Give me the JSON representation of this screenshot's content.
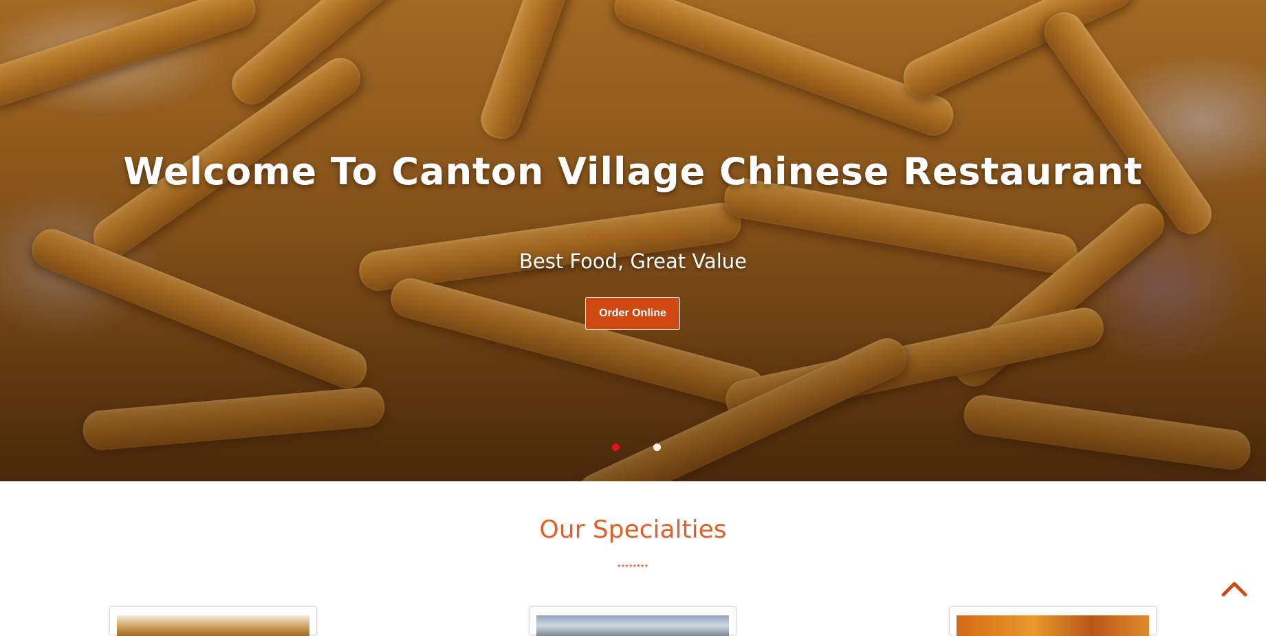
{
  "hero": {
    "title": "Welcome To Canton Village Chinese Restaurant",
    "divider": "********************",
    "tagline": "Best Food, Great Value",
    "order_button_label": "Order Online",
    "active_slide": 1,
    "slide_count": 2
  },
  "specialties": {
    "title": "Our Specialties",
    "divider": "********"
  },
  "icons": {
    "scroll_top": "chevron-up-icon"
  },
  "colors": {
    "accent": "#cf4a12",
    "section_title": "#e0602a",
    "active_dot": "#e8101a",
    "inactive_dot": "#fff5e6"
  }
}
